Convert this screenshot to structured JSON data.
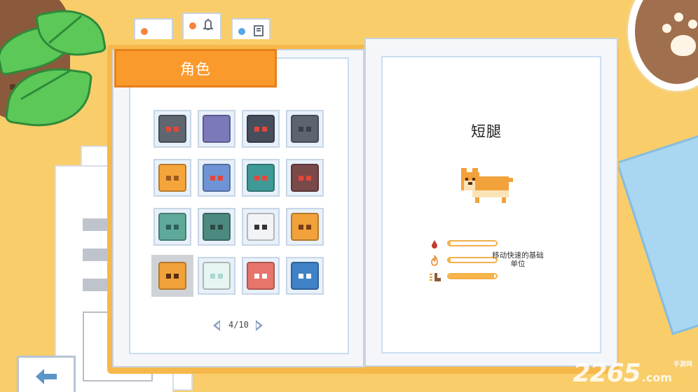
{
  "colors": {
    "desk": "#f9cd6a",
    "banner": "#fb9a2c",
    "accent_bar": "#f7b54a"
  },
  "tabs": [
    {
      "dot_color": "#f6843d",
      "icon": ""
    },
    {
      "dot_color": "#f6843d",
      "icon": "bell-icon"
    },
    {
      "dot_color": "#5aa6e6",
      "icon": "book-icon"
    }
  ],
  "header": {
    "title": "角色"
  },
  "characters": [
    {
      "name": "char-spiky-gray",
      "body": "#5f6670",
      "eye": "#e4473a"
    },
    {
      "name": "char-purple-cat",
      "body": "#7b79b9",
      "eye": "#7b79b9"
    },
    {
      "name": "char-dark-cat",
      "body": "#464e5c",
      "eye": "#e4473a"
    },
    {
      "name": "char-gray-bear",
      "body": "#5c6470",
      "eye": "#3a3f48"
    },
    {
      "name": "char-orange-duck",
      "body": "#f5a63b",
      "eye": "#a05a1f"
    },
    {
      "name": "char-blue-cat",
      "body": "#6f94d6",
      "eye": "#e4473a"
    },
    {
      "name": "char-teal-bird",
      "body": "#3f9a97",
      "eye": "#e4473a"
    },
    {
      "name": "char-brown-bear",
      "body": "#7a4a4a",
      "eye": "#e4473a"
    },
    {
      "name": "char-teal-frog",
      "body": "#5fa99b",
      "eye": "#2e5f59"
    },
    {
      "name": "char-green-frog",
      "body": "#4c8a80",
      "eye": "#2e4a45"
    },
    {
      "name": "char-white-chicken",
      "body": "#f1f3f6",
      "eye": "#333333"
    },
    {
      "name": "char-orange-dog",
      "body": "#f2a23a",
      "eye": "#7a3d14"
    },
    {
      "name": "char-corgi",
      "body": "#f2a23a",
      "eye": "#5a2d10"
    },
    {
      "name": "char-ghost",
      "body": "#e6f5f2",
      "eye": "#a8d8cf"
    },
    {
      "name": "char-red-mailbox",
      "body": "#e7756b",
      "eye": "#ffffff"
    },
    {
      "name": "char-blue-fish",
      "body": "#3f82c7",
      "eye": "#ffffff"
    }
  ],
  "selected_index": 12,
  "pager": {
    "text": "4/10"
  },
  "detail": {
    "title": "短腿",
    "stats": [
      {
        "icon": "blood-drop-icon",
        "color": "#c23a2b",
        "value": 0.05
      },
      {
        "icon": "fire-icon",
        "color": "#e58a2a",
        "value": 0.05
      },
      {
        "icon": "boot-icon",
        "color": "#8a5c3a",
        "value": 0.95
      }
    ],
    "description_line1": "移动快速的基础",
    "description_line2": "单位"
  },
  "back_button": {
    "icon": "arrow-left-icon"
  },
  "watermark": {
    "big": "2265",
    "small": ".com",
    "cn": "手游网"
  }
}
